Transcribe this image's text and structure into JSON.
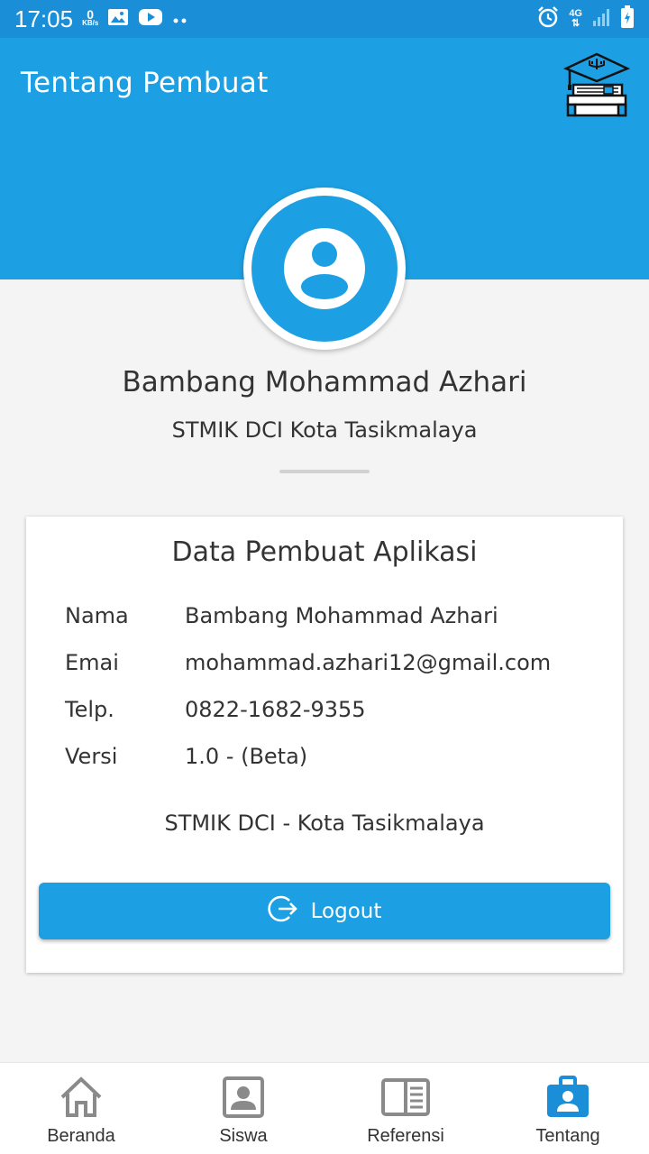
{
  "status_bar": {
    "time": "17:05",
    "speed_value": "0",
    "speed_unit": "KB/s",
    "network": "4G",
    "icons": [
      "image-icon",
      "youtube-icon",
      "more-dots-icon",
      "alarm-icon",
      "signal-icon",
      "battery-icon"
    ]
  },
  "app_bar": {
    "title": "Tentang Pembuat",
    "logo_icon": "graduation-books-icon",
    "color": "#1ca0e3"
  },
  "profile": {
    "avatar_icon": "account-circle-icon",
    "name": "Bambang Mohammad Azhari",
    "institution": "STMIK DCI Kota Tasikmalaya"
  },
  "card": {
    "title": "Data Pembuat Aplikasi",
    "rows": [
      {
        "label": "Nama",
        "value": "Bambang Mohammad Azhari"
      },
      {
        "label": "Emai",
        "value": "mohammad.azhari12@gmail.com"
      },
      {
        "label": "Telp.",
        "value": "0822-1682-9355"
      },
      {
        "label": "Versi",
        "value": "1.0 - (Beta)"
      }
    ],
    "footer": "STMIK DCI - Kota Tasikmalaya",
    "logout_label": "Logout"
  },
  "bottom_nav": {
    "items": [
      {
        "label": "Beranda",
        "icon": "home-icon",
        "active": false
      },
      {
        "label": "Siswa",
        "icon": "portrait-icon",
        "active": false
      },
      {
        "label": "Referensi",
        "icon": "book-open-icon",
        "active": false
      },
      {
        "label": "Tentang",
        "icon": "badge-briefcase-icon",
        "active": true
      }
    ],
    "active_color": "#1a8fd8",
    "inactive_color": "#8a8a8a"
  }
}
